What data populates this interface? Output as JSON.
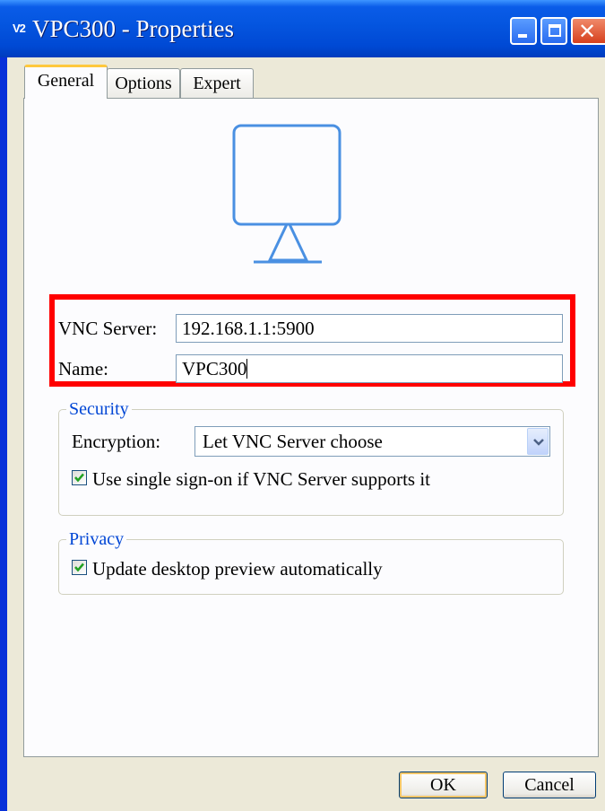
{
  "window": {
    "app_icon": "V2",
    "title": "VPC300 - Properties",
    "controls": {
      "minimize": "minimize-icon",
      "maximize": "maximize-icon",
      "close": "close-icon"
    }
  },
  "tabs": [
    {
      "label": "General",
      "active": true
    },
    {
      "label": "Options",
      "active": false
    },
    {
      "label": "Expert",
      "active": false
    }
  ],
  "general": {
    "preview_icon": "monitor-icon",
    "vnc_server": {
      "label": "VNC Server:",
      "value": "192.168.1.1:5900"
    },
    "name": {
      "label": "Name:",
      "value": "VPC300"
    },
    "highlight_color": "#ff0000"
  },
  "security": {
    "title": "Security",
    "encryption_label": "Encryption:",
    "encryption_value": "Let VNC Server choose",
    "sso_label": "Use single sign-on if VNC Server supports it",
    "sso_checked": true
  },
  "privacy": {
    "title": "Privacy",
    "preview_label": "Update desktop preview automatically",
    "preview_checked": true
  },
  "buttons": {
    "ok": "OK",
    "cancel": "Cancel"
  },
  "colors": {
    "titlebar": "#0556e0",
    "group_title": "#0046d5",
    "monitor_stroke": "#4a90e2"
  }
}
